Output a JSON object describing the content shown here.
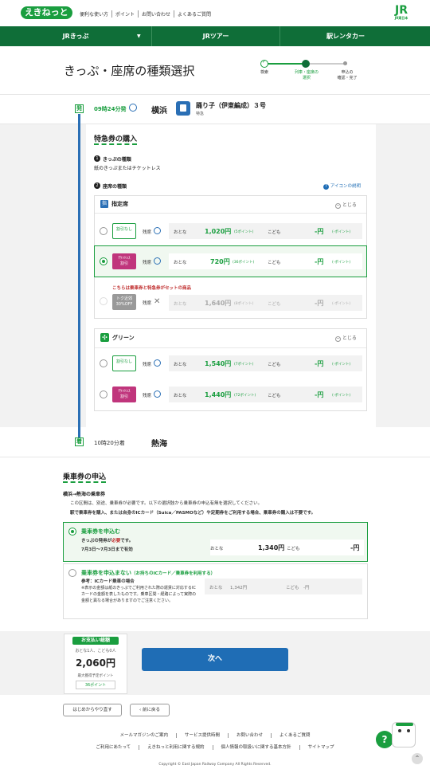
{
  "header": {
    "logo": "えきねっと",
    "links": [
      "便利な使い方",
      "ポイント",
      "お問い合わせ",
      "よくあるご質問"
    ],
    "jr_logo": "JR",
    "jr_sub": "JR東日本"
  },
  "nav": {
    "items": [
      "JRきっぷ",
      "JRツアー",
      "駅レンタカー"
    ],
    "dropdown_icon": "chevron-down-icon"
  },
  "page": {
    "title": "きっぷ・座席の種類選択"
  },
  "steps": [
    {
      "label": "検索",
      "state": "done"
    },
    {
      "label": "列車・座席の\n選択",
      "state": "current"
    },
    {
      "label": "申込の\n確認・完了",
      "state": "todo"
    }
  ],
  "departure": {
    "badge": "発",
    "time": "09時24分発",
    "station": "横浜",
    "train_name": "踊り子（伊東編成）３号",
    "train_type": "特急"
  },
  "express": {
    "section_title": "特急券の購入",
    "ticket_kind_num": "1",
    "ticket_kind_title": "きっぷの種類",
    "ticket_kind_value": "紙のきっぷまたはチケットレス",
    "seat_kind_num": "2",
    "seat_kind_title": "座席の種類",
    "icon_help": "アイコンの説明",
    "reserved": {
      "title": "指定席",
      "close": "とじる",
      "rows": [
        {
          "tag": "割引なし",
          "seat_label": "残席",
          "adult_label": "おとな",
          "adult_price": "1,020円",
          "adult_pt": "(5ポイント)",
          "child_label": "こども",
          "child_price": "-円",
          "child_pt": "(-ポイント)"
        },
        {
          "tag": "ﾁｹｯﾄﾚｽ\n割引",
          "seat_label": "残席",
          "adult_label": "おとな",
          "adult_price": "720円",
          "adult_pt": "(36ポイント)",
          "child_label": "こども",
          "child_price": "-円",
          "child_pt": "(-ポイント)"
        },
        {
          "tag": "トク近郊\n30%OFF",
          "seat_label": "残席",
          "adult_label": "おとな",
          "adult_price": "1,640円",
          "adult_pt": "(8ポイント)",
          "child_label": "こども",
          "child_price": "-円",
          "child_pt": "(-ポイント)"
        }
      ],
      "set_note": "こちらは乗車券と特急券がセットの商品"
    },
    "green": {
      "title": "グリーン",
      "close": "とじる",
      "rows": [
        {
          "tag": "割引なし",
          "seat_label": "残席",
          "adult_label": "おとな",
          "adult_price": "1,540円",
          "adult_pt": "(7ポイント)",
          "child_label": "こども",
          "child_price": "-円",
          "child_pt": "(-ポイント)"
        },
        {
          "tag": "ﾁｹｯﾄﾚｽ\n割引",
          "seat_label": "残席",
          "adult_label": "おとな",
          "adult_price": "1,440円",
          "adult_pt": "(72ポイント)",
          "child_label": "こども",
          "child_price": "-円",
          "child_pt": "(-ポイント)"
        }
      ]
    }
  },
  "arrival": {
    "badge": "着",
    "time": "10時20分着",
    "station": "熱海"
  },
  "boarding": {
    "section_title": "乗車券の申込",
    "route": "横浜→熱海の乗車券",
    "note1": "この区間は、別途、乗車券が必要です。以下の選択肢から乗車券の申込有無を選択してください。",
    "note2": "駅で乗車券を購入、または自身のICカード（Suica／PASMOなど）や定期券をご利用する場合、乗車券の購入は不要です。",
    "opt1_title": "乗車券を申込む",
    "opt1_line1a": "きっぷの発券が",
    "opt1_line1b": "必要",
    "opt1_line1c": "です。",
    "opt1_line2": "7月3日〜7月3日まで有効",
    "opt1_adult_label": "おとな",
    "opt1_adult_price": "1,340円",
    "opt1_child_label": "こども",
    "opt1_child_price": "-円",
    "opt2_title": "乗車券を申込まない",
    "opt2_sub": "（お持ちのICカード／乗車券を利用する）",
    "opt2_ref": "参考：ICカード乗車の場合",
    "opt2_note": "※表示の金額は紙のきっぷでご利用された際の運賃に対応するICカードの金額を表したものです。乗車区間・経路によって実際の金額と異なる場合がありますのでご注意ください。",
    "opt2_adult_label": "おとな",
    "opt2_adult_price": "1,342円",
    "opt2_child_label": "こども",
    "opt2_child_price": "-円"
  },
  "payment": {
    "head": "お支払い総額",
    "persons": "おとな1人、こども0人",
    "total": "2,060円",
    "points_label": "最大獲得予定ポイント",
    "points": "36ポイント"
  },
  "actions": {
    "next": "次へ",
    "restart": "はじめからやり直す",
    "back": "前に戻る"
  },
  "footer": {
    "row1": [
      "メールマガジンのご案内",
      "サービス提供時間",
      "お問い合わせ",
      "よくあるご質問"
    ],
    "row2": [
      "ご利用にあたって",
      "えきねっと利用に関する規約",
      "個人情報の取扱いに関する基本方針",
      "サイトマップ"
    ],
    "copyright": "Copyright © East Japan Railway Company All Rights Reserved."
  },
  "colors": {
    "brand_green": "#1a9e3f",
    "nav_green": "#0f6e38",
    "accent_blue": "#1f6db5",
    "pink": "#c0357c"
  }
}
